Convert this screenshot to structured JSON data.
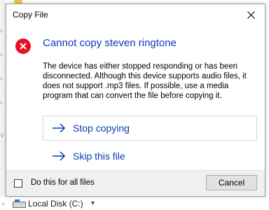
{
  "background": {
    "drive_label": "Local Disk (C:)"
  },
  "dialog": {
    "title": "Copy File",
    "heading": "Cannot copy steven ringtone",
    "description": "The device has either stopped responding or has been disconnected. Although this device supports audio files, it does not support .mp3 files. If possible, use a media program that can convert the file before copying it.",
    "options": [
      {
        "label": "Stop copying",
        "icon": "arrow-right-icon"
      },
      {
        "label": "Skip this file",
        "icon": "arrow-right-icon"
      }
    ],
    "checkbox_label": "Do this for all files",
    "checkbox_checked": false,
    "cancel_label": "Cancel",
    "colors": {
      "accent": "#0b3db5",
      "error": "#e81123",
      "footer": "#f0f0f0"
    }
  }
}
